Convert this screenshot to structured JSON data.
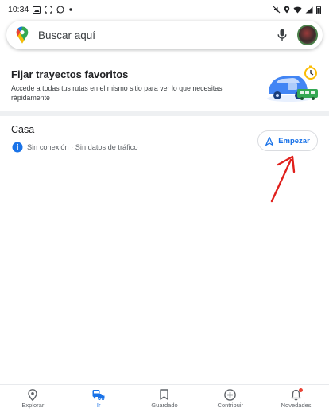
{
  "status_bar": {
    "time": "10:34",
    "battery_text": ""
  },
  "search": {
    "placeholder": "Buscar aquí"
  },
  "banner": {
    "title": "Fijar trayectos favoritos",
    "description": "Accede a todas tus rutas en el mismo sitio para ver lo que necesitas rápidamente"
  },
  "route": {
    "title": "Casa",
    "status": "Sin conexión · Sin datos de tráfico",
    "start_label": "Empezar"
  },
  "nav": {
    "items": [
      {
        "label": "Explorar",
        "icon": "location-pin-icon"
      },
      {
        "label": "Ir",
        "icon": "commute-icon"
      },
      {
        "label": "Guardado",
        "icon": "bookmark-icon"
      },
      {
        "label": "Contribuir",
        "icon": "add-circle-icon"
      },
      {
        "label": "Novedades",
        "icon": "bell-icon"
      }
    ]
  },
  "colors": {
    "accent": "#1a73e8",
    "annotation_arrow": "#e0201c",
    "notification": "#ea4335"
  }
}
